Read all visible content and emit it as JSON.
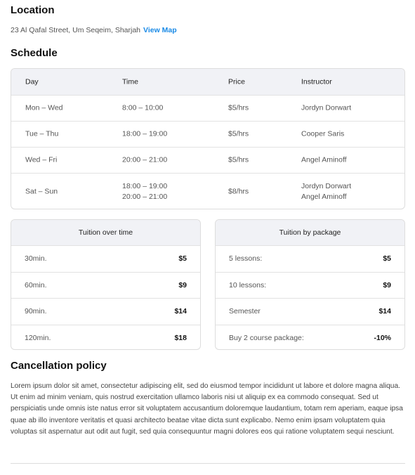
{
  "location": {
    "title": "Location",
    "address": "23 Al Qafal Street, Um Seqeim, Sharjah",
    "link": "View Map",
    "link_color": "#1a8ae6"
  },
  "schedule": {
    "title": "Schedule",
    "headers": [
      "Day",
      "Time",
      "Price",
      "Instructor"
    ],
    "rows": [
      {
        "day": "Mon – Wed",
        "time": [
          "8:00 – 10:00"
        ],
        "price": "$5/hrs",
        "instructor": [
          "Jordyn Dorwart"
        ]
      },
      {
        "day": "Tue – Thu",
        "time": [
          "18:00 – 19:00"
        ],
        "price": "$5/hrs",
        "instructor": [
          "Cooper Saris"
        ]
      },
      {
        "day": "Wed – Fri",
        "time": [
          "20:00 – 21:00"
        ],
        "price": "$5/hrs",
        "instructor": [
          "Angel Aminoff"
        ]
      },
      {
        "day": "Sat – Sun",
        "time": [
          "18:00 – 19:00",
          "20:00 – 21:00"
        ],
        "price": "$8/hrs",
        "instructor": [
          "Jordyn Dorwart",
          "Angel Aminoff"
        ]
      }
    ]
  },
  "tuition_time": {
    "title": "Tuition over time",
    "rows": [
      {
        "label": "30min.",
        "value": "$5"
      },
      {
        "label": "60min.",
        "value": "$9"
      },
      {
        "label": "90min.",
        "value": "$14"
      },
      {
        "label": "120min.",
        "value": "$18"
      }
    ]
  },
  "tuition_package": {
    "title": "Tuition by package",
    "rows": [
      {
        "label": "5 lessons:",
        "value": "$5"
      },
      {
        "label": "10 lessons:",
        "value": "$9"
      },
      {
        "label": "Semester",
        "value": "$14"
      },
      {
        "label": "Buy 2 course package:",
        "value": "-10%"
      }
    ]
  },
  "cancellation": {
    "title": "Cancellation policy",
    "text": "Lorem ipsum dolor sit amet, consectetur adipiscing elit, sed do eiusmod tempor incididunt ut labore et dolore magna aliqua. Ut enim ad minim veniam, quis nostrud exercitation ullamco laboris nisi ut aliquip ex ea commodo consequat. Sed ut perspiciatis unde omnis iste natus error sit voluptatem accusantium doloremque laudantium, totam rem aperiam, eaque ipsa quae ab illo inventore veritatis et quasi architecto beatae vitae dicta sunt explicabo. Nemo enim ipsam voluptatem quia voluptas sit aspernatur aut odit aut fugit, sed quia consequuntur magni dolores eos qui ratione voluptatem sequi nesciunt."
  }
}
